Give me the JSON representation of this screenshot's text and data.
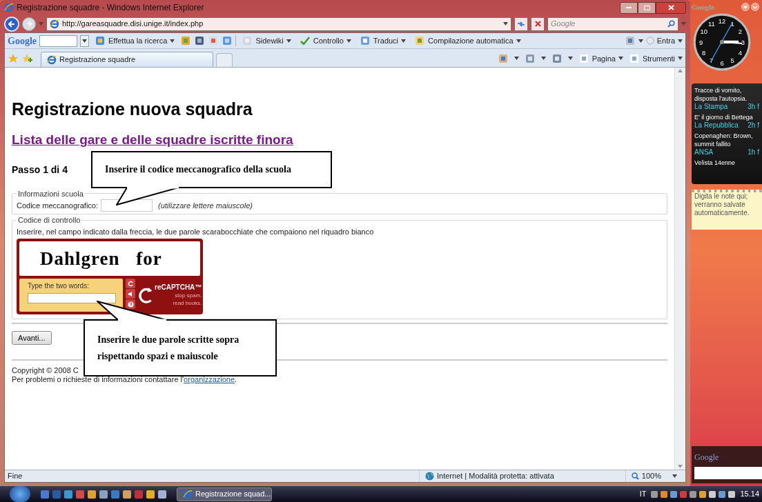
{
  "window": {
    "title": "Registrazione squadre - Windows Internet Explorer"
  },
  "address_bar": {
    "url": "http://gareasquadre.disi.unige.it/index.php"
  },
  "search_box": {
    "placeholder": "Google"
  },
  "google_toolbar": {
    "logo": "Google",
    "items": [
      {
        "label": "Effettua la ricerca"
      },
      {
        "label": "Sidewiki"
      },
      {
        "label": "Controllo"
      },
      {
        "label": "Traduci"
      },
      {
        "label": "Compilazione automatica"
      }
    ],
    "sign_in": "Entra"
  },
  "tabs": [
    {
      "label": "Registrazione squadre",
      "selected": true
    }
  ],
  "command_bar": [
    "Pagina",
    "Strumenti"
  ],
  "page": {
    "heading": "Registrazione nuova squadra",
    "list_link": "Lista delle gare e delle squadre iscritte finora",
    "step": "Passo 1 di 4",
    "school": {
      "legend": "Informazioni scuola",
      "label": "Codice meccanografico:",
      "hint": "(utilizzare lettere maiuscole)"
    },
    "control": {
      "legend": "Codice di controllo",
      "instruction": "Inserire, nel campo indicato dalla freccia, le due parole scarabocchiate che compaiono nel riquadro bianco",
      "captcha": {
        "words": "Dahlgren for",
        "prompt": "Type the two words:",
        "logo": "reCAPTCHA™",
        "tagline": [
          "stop spam.",
          "read books."
        ]
      }
    },
    "next_button": "Avanti...",
    "copyright": "Copyright © 2008 C",
    "contact": {
      "text": "Per problemi o richieste di informazioni contattare l'",
      "link": "organizzazione",
      "after": "."
    }
  },
  "callouts": [
    {
      "lines": [
        "Inserire il codice meccanografico della scuola"
      ]
    },
    {
      "lines": [
        "Inserire le due parole scritte sopra",
        "rispettando spazi e maiuscole"
      ]
    }
  ],
  "status_bar": {
    "text": "Fine",
    "zone": "Internet | Modalità protetta: attivata",
    "zoom": "100%"
  },
  "sidebar": {
    "logo": "Google",
    "clock_numbers": [
      "12",
      "11",
      "1",
      "10",
      "2",
      "9",
      "3",
      "8",
      "4",
      "7",
      "5",
      "6"
    ],
    "news": [
      {
        "headline": "Tracce di vomito, disposta l'autopsia.",
        "source": "La Stampa",
        "age": "3h f"
      },
      {
        "headline": "E' il giorno di Bettega",
        "source": "La Repubblica",
        "age": "2h f"
      },
      {
        "headline": "Copenaghen: Brown, summit fallito",
        "source": "ANSA",
        "age": "1h f"
      },
      {
        "headline": "Velista 14enne"
      }
    ],
    "note": "Digita le note qui; verranno salvate automaticamente.",
    "search_logo": "Google"
  },
  "taskbar": {
    "task": "Registrazione squad...",
    "language": "IT",
    "time": "15.14"
  }
}
